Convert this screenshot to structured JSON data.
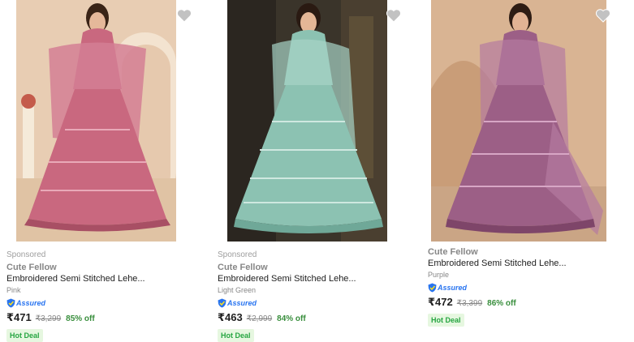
{
  "products": [
    {
      "sponsored": "Sponsored",
      "brand": "Cute Fellow",
      "title": "Embroidered Semi Stitched Lehe...",
      "color": "Pink",
      "assured": "Assured",
      "price": "₹471",
      "mrp": "₹3,299",
      "discount": "85% off",
      "badge": "Hot Deal",
      "dress_color": "#c9687f",
      "bg_color": "#e8cdb3",
      "icon": "heart-icon"
    },
    {
      "sponsored": "Sponsored",
      "brand": "Cute Fellow",
      "title": "Embroidered Semi Stitched Lehe...",
      "color": "Light Green",
      "assured": "Assured",
      "price": "₹463",
      "mrp": "₹2,999",
      "discount": "84% off",
      "badge": "Hot Deal",
      "dress_color": "#8cc2b2",
      "bg_color": "#3a342a",
      "icon": "heart-icon"
    },
    {
      "sponsored": "",
      "brand": "Cute Fellow",
      "title": "Embroidered Semi Stitched Lehe...",
      "color": "Purple",
      "assured": "Assured",
      "price": "₹472",
      "mrp": "₹3,399",
      "discount": "86% off",
      "badge": "Hot Deal",
      "dress_color": "#9c5f86",
      "bg_color": "#d9b493",
      "icon": "heart-icon"
    }
  ]
}
